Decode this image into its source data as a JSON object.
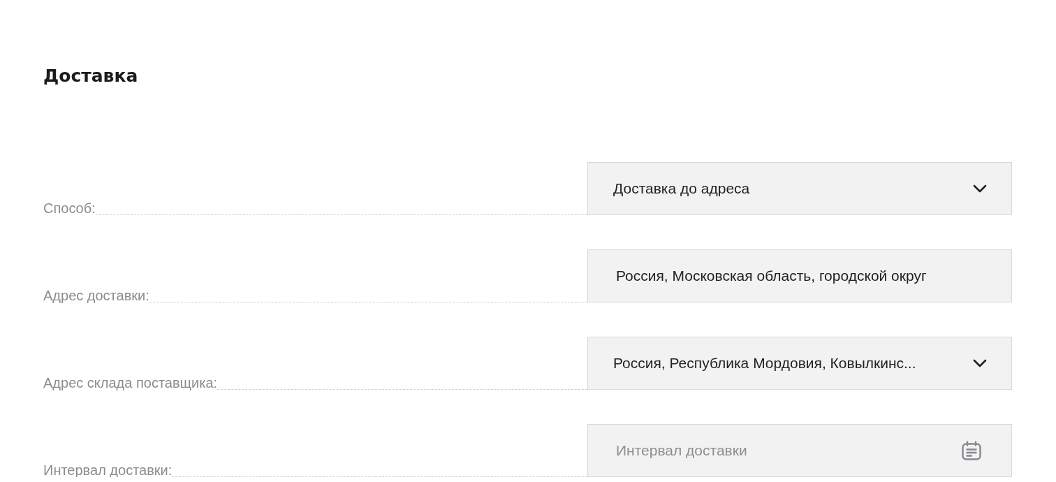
{
  "section": {
    "title": "Доставка"
  },
  "fields": [
    {
      "kind": "select",
      "label": "Способ:",
      "value": "Доставка до адреса"
    },
    {
      "kind": "text",
      "label": "Адрес доставки:",
      "value": "Россия, Московская область, городской округ"
    },
    {
      "kind": "select",
      "label": "Адрес склада поставщика:",
      "value": "Россия, Республика Мордовия, Ковылкинс..."
    },
    {
      "kind": "date",
      "label": "Интервал доставки:",
      "placeholder": "Интервал доставки"
    }
  ]
}
